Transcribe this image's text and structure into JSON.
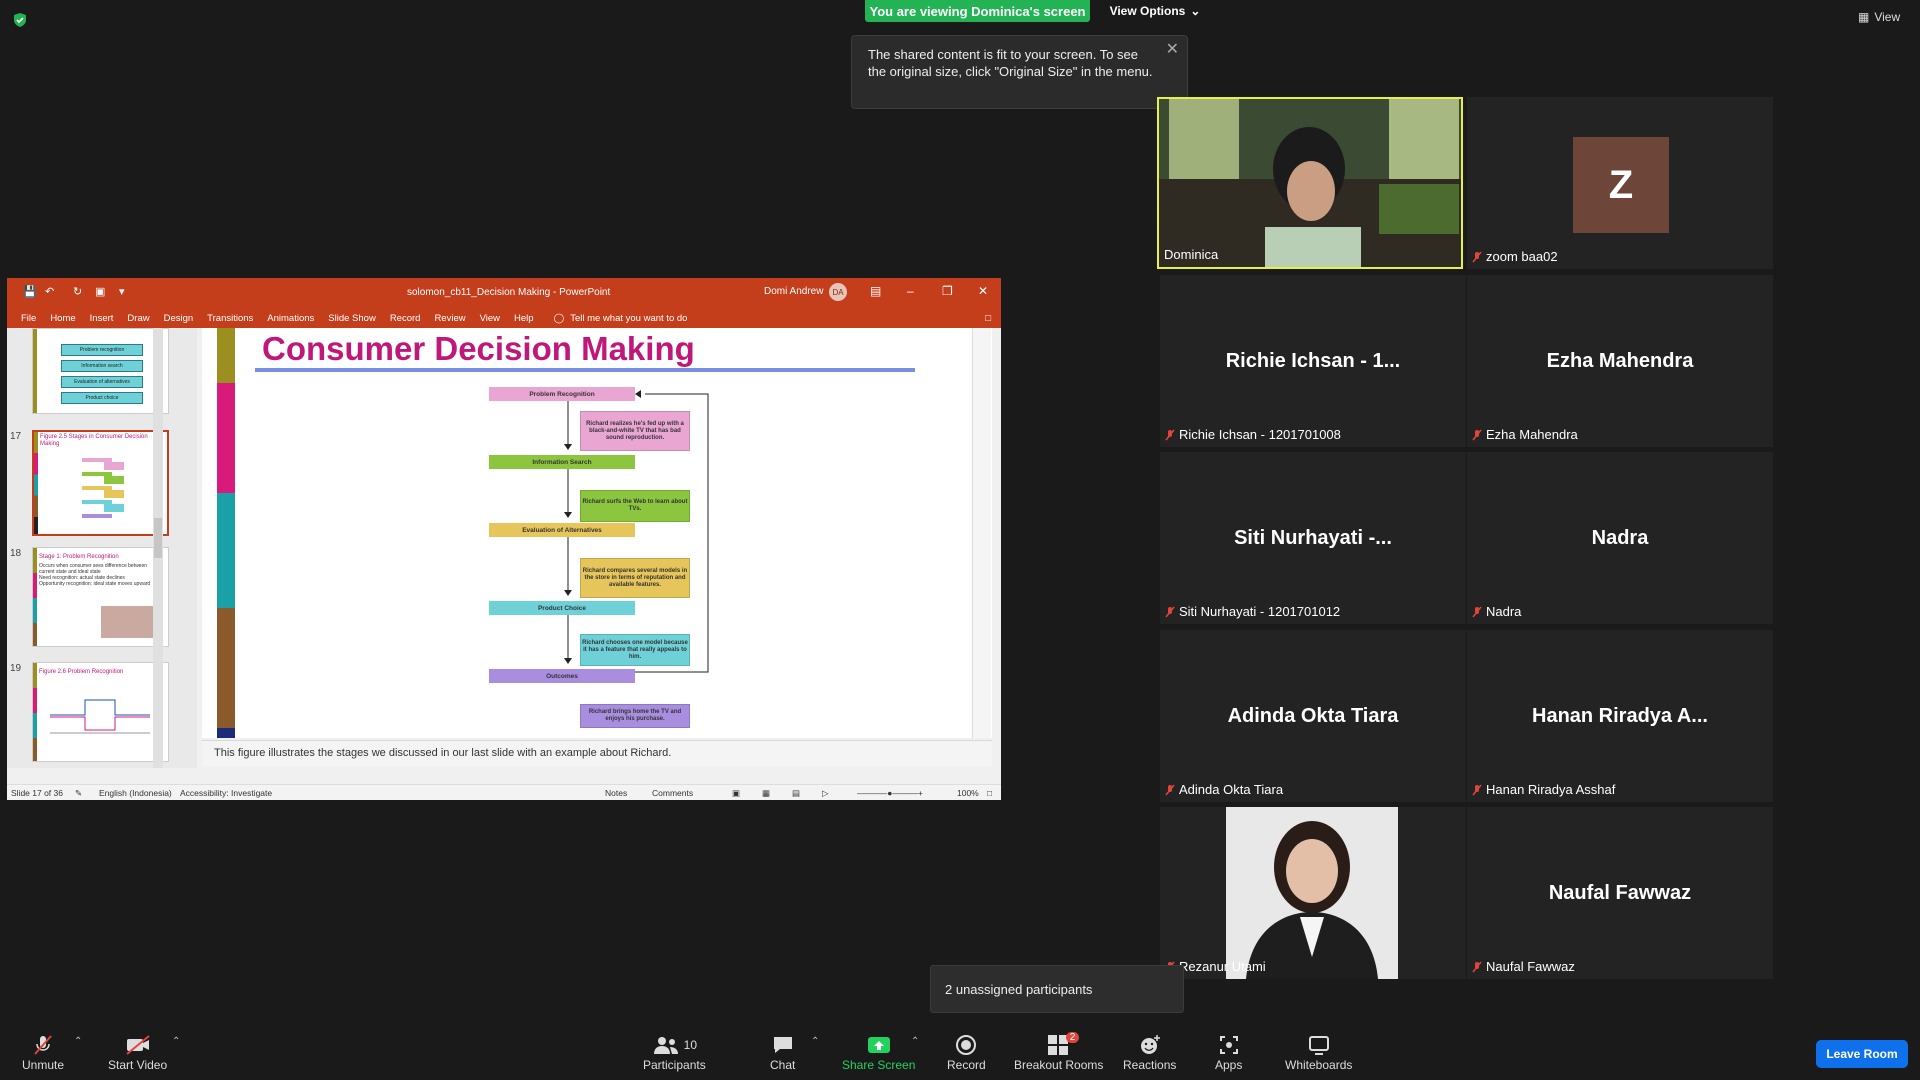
{
  "banner": {
    "viewing_text": "You are viewing Dominica's screen",
    "view_options_label": "View Options",
    "view_label": "View",
    "tooltip_text": "The shared content is fit to your screen. To see the original size, click \"Original Size\" in the menu."
  },
  "ppt": {
    "window_title": "solomon_cb11_Decision Making  -  PowerPoint",
    "user_name": "Domi Andrew",
    "user_initials": "DA",
    "menu": [
      "File",
      "Home",
      "Insert",
      "Draw",
      "Design",
      "Transitions",
      "Animations",
      "Slide Show",
      "Record",
      "Review",
      "View",
      "Help"
    ],
    "tell_me": "Tell me what you want to do",
    "thumbnails": [
      {
        "num": "",
        "title": "",
        "items": [
          "Problem recognition",
          "Information search",
          "Evaluation of alternatives",
          "Product choice"
        ]
      },
      {
        "num": "17",
        "title": "Figure 2.5 Stages in Consumer Decision Making"
      },
      {
        "num": "18",
        "title": "Stage 1: Problem Recognition",
        "bullets": [
          "Occurs when consumer sees difference between current state and ideal state",
          "Need recognition: actual state declines",
          "Opportunity recognition: ideal state moves upward"
        ]
      },
      {
        "num": "19",
        "title": "Figure 2.6 Problem Recognition"
      }
    ],
    "slide_title": "Consumer Decision Making",
    "stages": [
      "Problem Recognition",
      "Information Search",
      "Evaluation of Alternatives",
      "Product Choice",
      "Outcomes"
    ],
    "stage_colors": [
      "#e9a6d2",
      "#8cc63f",
      "#e6c55a",
      "#6fd1d8",
      "#a98ee0"
    ],
    "notes_boxes": [
      "Richard realizes he's fed up with a black-and-white TV that has bad sound reproduction.",
      "Richard surfs the Web to learn about TVs.",
      "Richard compares several models in the store in terms of reputation and available features.",
      "Richard chooses one model because it has a feature that really appeals to him.",
      "Richard brings home the TV and enjoys his purchase."
    ],
    "speaker_notes": "This figure illustrates the stages we discussed in our last slide with an example about Richard.",
    "status": {
      "slide_info": "Slide 17 of 36",
      "language": "English (Indonesia)",
      "accessibility": "Accessibility: Investigate",
      "notes": "Notes",
      "comments": "Comments",
      "zoom": "100%"
    }
  },
  "participants": [
    {
      "big": "",
      "label": "Dominica",
      "muted": false,
      "type": "video"
    },
    {
      "big": "Z",
      "label": "zoom baa02",
      "muted": true,
      "type": "avatar"
    },
    {
      "big": "Richie Ichsan - 1...",
      "label": "Richie Ichsan - 1201701008",
      "muted": true
    },
    {
      "big": "Ezha Mahendra",
      "label": "Ezha Mahendra",
      "muted": true
    },
    {
      "big": "Siti Nurhayati -...",
      "label": "Siti Nurhayati - 1201701012",
      "muted": true
    },
    {
      "big": "Nadra",
      "label": "Nadra",
      "muted": true
    },
    {
      "big": "Adinda Okta Tiara",
      "label": "Adinda Okta Tiara",
      "muted": true
    },
    {
      "big": "Hanan Riradya A...",
      "label": "Hanan Riradya Asshaf",
      "muted": true
    },
    {
      "big": "",
      "label": "Rezanur Utami",
      "muted": true,
      "type": "photo"
    },
    {
      "big": "Naufal Fawwaz",
      "label": "Naufal Fawwaz",
      "muted": true
    }
  ],
  "unassigned": "2 unassigned participants",
  "toolbar": {
    "unmute": "Unmute",
    "start_video": "Start Video",
    "participants": "Participants",
    "participants_count": "10",
    "chat": "Chat",
    "share_screen": "Share Screen",
    "record": "Record",
    "breakout_rooms": "Breakout Rooms",
    "breakout_badge": "2",
    "reactions": "Reactions",
    "apps": "Apps",
    "whiteboards": "Whiteboards",
    "leave": "Leave Room"
  },
  "colors": {
    "ppt_accent": "#c43e1c",
    "viewing_green": "#23b355",
    "speaker_border": "#e6f04a",
    "leave_blue": "#0e71eb",
    "slide_title": "#c0187a"
  }
}
